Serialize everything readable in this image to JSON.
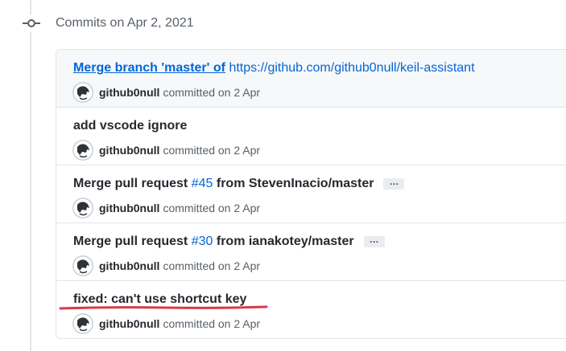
{
  "group": {
    "title": "Commits on Apr 2, 2021"
  },
  "commits": [
    {
      "link_text": "Merge branch 'master' of",
      "url_text": "https://github.com/github0null/keil-assistant",
      "author": "github0null",
      "committed_text": "committed on 2 Apr"
    },
    {
      "message": "add vscode ignore",
      "author": "github0null",
      "committed_text": "committed on 2 Apr"
    },
    {
      "prefix": "Merge pull request",
      "pr_number": "#45",
      "suffix": "from StevenInacio/master",
      "ellipsis": "…",
      "author": "github0null",
      "committed_text": "committed on 2 Apr"
    },
    {
      "prefix": "Merge pull request",
      "pr_number": "#30",
      "suffix": "from ianakotey/master",
      "ellipsis": "…",
      "author": "github0null",
      "committed_text": "committed on 2 Apr"
    },
    {
      "message": "fixed: can't use shortcut key",
      "author": "github0null",
      "committed_text": "committed on 2 Apr"
    }
  ],
  "icons": {
    "group_icon": "git-commit-icon",
    "avatar": "avatar-icon"
  },
  "colors": {
    "link": "#0366d6",
    "annotation_underline": "#d73a49"
  }
}
